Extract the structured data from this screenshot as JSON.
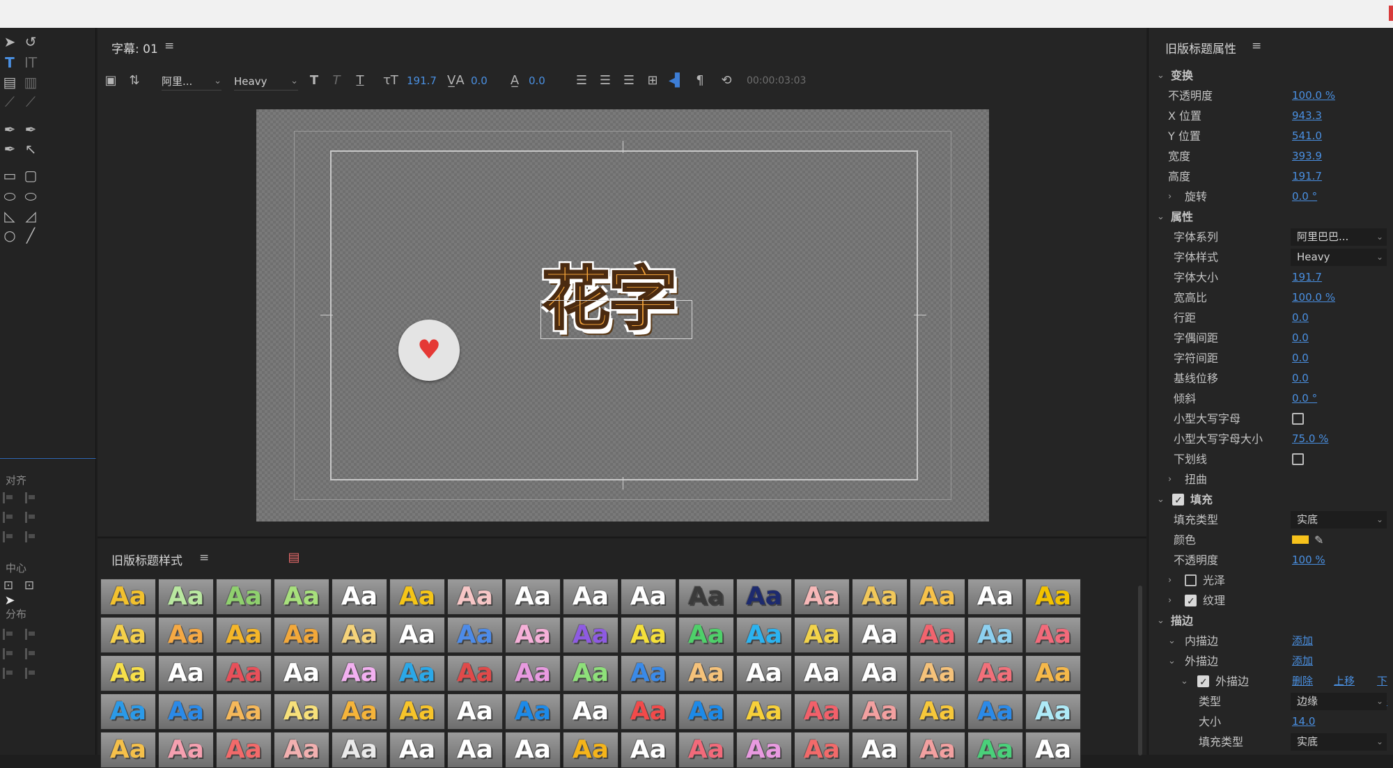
{
  "editor": {
    "panel_title": "字幕: 01",
    "font_family": "阿里...",
    "font_style": "Heavy",
    "font_size": "191.7",
    "kerning": "0.0",
    "leading": "0.0",
    "timecode": "00:00:03:03",
    "canvas_text": "花字"
  },
  "styles_panel": {
    "title": "旧版标题样式",
    "swatch_label": "Aa",
    "rows": [
      [
        "#f2c12e",
        "#b9e8a0",
        "#8fd06e",
        "#a7e07c",
        "#ffffff",
        "#f5c518",
        "#f7c6c6",
        "#ffffff",
        "#ffffff",
        "#ffffff",
        "#3a3a3a",
        "#1d2a6e",
        "#f7b8b8",
        "#f2c85a",
        "#f7c24a",
        "#ffffff",
        "#f2c200"
      ],
      [
        "#f5d04a",
        "#f5a944",
        "#f5b629",
        "#f2a83a",
        "#f5d37a",
        "#ffffff",
        "#4d8be8",
        "#f5b0d8",
        "#8e5be2",
        "#f5e03a",
        "#4fd06a",
        "#2bb3f0",
        "#f2d34a",
        "#ffffff",
        "#f2646e",
        "#8dd0f0",
        "#f26a7a"
      ],
      [
        "#f7e04a",
        "#ffffff",
        "#e8505a",
        "#ffffff",
        "#f2b0f0",
        "#2ba8e8",
        "#e04a4a",
        "#e89ae0",
        "#8ee07a",
        "#3a8ae8",
        "#f5c27a",
        "#ffffff",
        "#ffffff",
        "#ffffff",
        "#f5c27a",
        "#f2707a",
        "#f5b84a"
      ],
      [
        "#2b9ae8",
        "#2b8ae8",
        "#f5b85a",
        "#f7e07a",
        "#f5b43a",
        "#f7c42a",
        "#ffffff",
        "#1d8ae8",
        "#ffffff",
        "#f24a4a",
        "#1d8ae8",
        "#f7d03a",
        "#f2606a",
        "#f2a0a0",
        "#f7c83a",
        "#2b8ae8",
        "#aeeaf7"
      ],
      [
        "#f5c04a",
        "#f5a0b0",
        "#f26a6a",
        "#f2b0b0",
        "#eaeaea",
        "#ffffff",
        "#ffffff",
        "#ffffff",
        "#f5b41a",
        "#ffffff",
        "#f26a7a",
        "#e89ae0",
        "#f26a6a",
        "#ffffff",
        "#f2a0a0",
        "#4ad07a",
        "#ffffff"
      ]
    ]
  },
  "props": {
    "title": "旧版标题属性",
    "transform": {
      "section": "变换",
      "opacity_label": "不透明度",
      "opacity": "100.0 %",
      "x_label": "X 位置",
      "x": "943.3",
      "y_label": "Y 位置",
      "y": "541.0",
      "width_label": "宽度",
      "width": "393.9",
      "height_label": "高度",
      "height": "191.7",
      "rotation_label": "旋转",
      "rotation": "0.0 °"
    },
    "attributes": {
      "section": "属性",
      "family_label": "字体系列",
      "family": "阿里巴巴...",
      "style_label": "字体样式",
      "style": "Heavy",
      "size_label": "字体大小",
      "size": "191.7",
      "aspect_label": "宽高比",
      "aspect": "100.0 %",
      "leading_label": "行距",
      "leading": "0.0",
      "kerning_label": "字偶间距",
      "kerning": "0.0",
      "tracking_label": "字符间距",
      "tracking": "0.0",
      "baseline_label": "基线位移",
      "baseline": "0.0",
      "slant_label": "倾斜",
      "slant": "0.0 °",
      "smallcaps_label": "小型大写字母",
      "smallcaps_size_label": "小型大写字母大小",
      "smallcaps_size": "75.0 %",
      "underline_label": "下划线",
      "distort_label": "扭曲"
    },
    "fill": {
      "section": "填充",
      "type_label": "填充类型",
      "type": "实底",
      "color_label": "颜色",
      "color": "#f7c21b",
      "opacity_label": "不透明度",
      "opacity": "100 %",
      "sheen_label": "光泽",
      "texture_label": "纹理"
    },
    "strokes": {
      "section": "描边",
      "inner_label": "内描边",
      "inner_action": "添加",
      "outer_label": "外描边",
      "outer_action": "添加",
      "outer_item_label": "外描边",
      "delete_action": "删除",
      "up_action": "上移",
      "down_action": "下移",
      "type_label": "类型",
      "type": "边缘",
      "size_label": "大小",
      "size": "14.0",
      "filltype_label": "填充类型",
      "filltype": "实底"
    }
  },
  "align_panel": {
    "align_label": "对齐",
    "center_label": "中心",
    "distribute_label": "分布"
  }
}
